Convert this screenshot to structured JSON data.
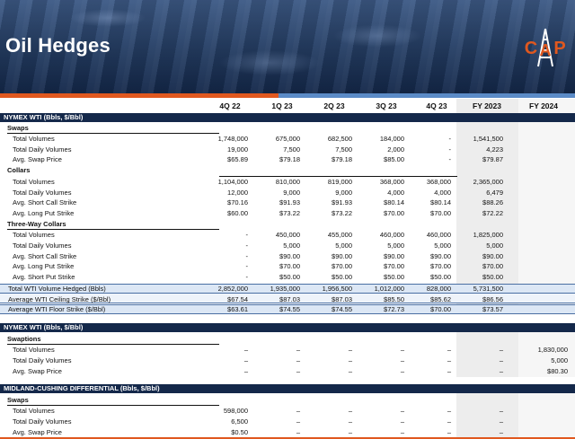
{
  "header": {
    "title": "Oil Hedges",
    "logo_letters": [
      "C",
      "A",
      "P"
    ],
    "accent_orange": "#e0581f",
    "accent_blue": "#5b8bc7",
    "navy": "#14284a"
  },
  "columns": [
    "4Q 22",
    "1Q 23",
    "2Q 23",
    "3Q 23",
    "4Q 23",
    "FY 2023",
    "FY 2024"
  ],
  "sections": {
    "nymex1": {
      "title": "NYMEX WTI (Bbls, $/Bbl)",
      "swaps": {
        "label": "Swaps",
        "rows": [
          {
            "label": "Total Volumes",
            "values": [
              "1,748,000",
              "675,000",
              "682,500",
              "184,000",
              "-",
              "1,541,500",
              ""
            ]
          },
          {
            "label": "Total Daily Volumes",
            "values": [
              "19,000",
              "7,500",
              "7,500",
              "2,000",
              "-",
              "4,223",
              ""
            ]
          },
          {
            "label": "Avg. Swap Price",
            "values": [
              "$65.89",
              "$79.18",
              "$79.18",
              "$85.00",
              "-",
              "$79.87",
              ""
            ]
          }
        ]
      },
      "collars": {
        "label": "Collars",
        "rows": [
          {
            "label": "Total Volumes",
            "values": [
              "1,104,000",
              "810,000",
              "819,000",
              "368,000",
              "368,000",
              "2,365,000",
              ""
            ]
          },
          {
            "label": "Total Daily Volumes",
            "values": [
              "12,000",
              "9,000",
              "9,000",
              "4,000",
              "4,000",
              "6,479",
              ""
            ]
          },
          {
            "label": "Avg. Short Call Strike",
            "values": [
              "$70.16",
              "$91.93",
              "$91.93",
              "$80.14",
              "$80.14",
              "$88.26",
              ""
            ]
          },
          {
            "label": "Avg. Long Put Strike",
            "values": [
              "$60.00",
              "$73.22",
              "$73.22",
              "$70.00",
              "$70.00",
              "$72.22",
              ""
            ]
          }
        ]
      },
      "three_way": {
        "label": "Three-Way Collars",
        "rows": [
          {
            "label": "Total Volumes",
            "values": [
              "-",
              "450,000",
              "455,000",
              "460,000",
              "460,000",
              "1,825,000",
              ""
            ]
          },
          {
            "label": "Total Daily Volumes",
            "values": [
              "-",
              "5,000",
              "5,000",
              "5,000",
              "5,000",
              "5,000",
              ""
            ]
          },
          {
            "label": "Avg. Short Call Strike",
            "values": [
              "-",
              "$90.00",
              "$90.00",
              "$90.00",
              "$90.00",
              "$90.00",
              ""
            ]
          },
          {
            "label": "Avg. Long Put Strike",
            "values": [
              "-",
              "$70.00",
              "$70.00",
              "$70.00",
              "$70.00",
              "$70.00",
              ""
            ]
          },
          {
            "label": "Avg. Short Put Strike",
            "values": [
              "-",
              "$50.00",
              "$50.00",
              "$50.00",
              "$50.00",
              "$50.00",
              ""
            ]
          }
        ]
      },
      "totals": [
        {
          "label": "Total WTI Volume Hedged (Bbls)",
          "values": [
            "2,852,000",
            "1,935,000",
            "1,956,500",
            "1,012,000",
            "828,000",
            "5,731,500",
            ""
          ]
        },
        {
          "label": "Average WTI Ceiling Strike ($/Bbl)",
          "values": [
            "$67.54",
            "$87.03",
            "$87.03",
            "$85.50",
            "$85.62",
            "$86.56",
            ""
          ]
        },
        {
          "label": "Average WTI Floor Strike ($/Bbl)",
          "values": [
            "$63.61",
            "$74.55",
            "$74.55",
            "$72.73",
            "$70.00",
            "$73.57",
            ""
          ]
        }
      ]
    },
    "nymex2": {
      "title": "NYMEX WTI (Bbls, $/Bbl)",
      "swaptions": {
        "label": "Swaptions",
        "rows": [
          {
            "label": "Total Volumes",
            "values": [
              "–",
              "–",
              "–",
              "–",
              "–",
              "–",
              "1,830,000"
            ]
          },
          {
            "label": "Total Daily Volumes",
            "values": [
              "–",
              "–",
              "–",
              "–",
              "–",
              "–",
              "5,000"
            ]
          },
          {
            "label": "Avg. Swap Price",
            "values": [
              "–",
              "–",
              "–",
              "–",
              "–",
              "–",
              "$80.30"
            ]
          }
        ]
      }
    },
    "midland": {
      "title": "MIDLAND-CUSHING DIFFERENTIAL (Bbls, $/Bbl)",
      "swaps": {
        "label": "Swaps",
        "rows": [
          {
            "label": "Total Volumes",
            "values": [
              "598,000",
              "–",
              "–",
              "–",
              "–",
              "–",
              ""
            ]
          },
          {
            "label": "Total Daily Volumes",
            "values": [
              "6,500",
              "–",
              "–",
              "–",
              "–",
              "–",
              ""
            ]
          },
          {
            "label": "Avg. Swap Price",
            "values": [
              "$0.50",
              "–",
              "–",
              "–",
              "–",
              "–",
              ""
            ]
          }
        ]
      }
    }
  }
}
